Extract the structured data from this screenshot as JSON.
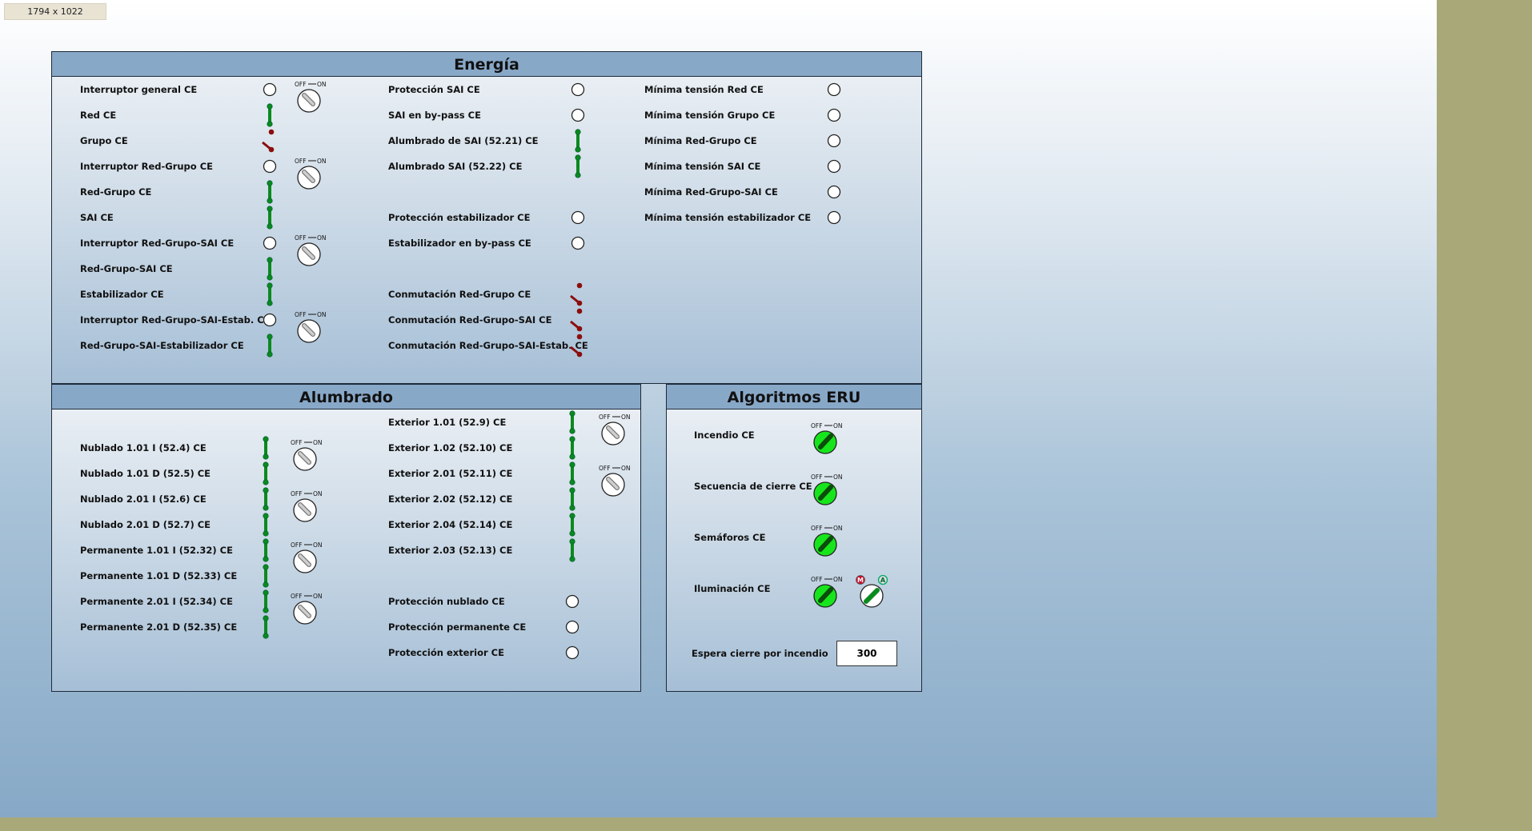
{
  "resolution_label": "1794 x 1022",
  "energia": {
    "title": "Energía",
    "col1": [
      {
        "label": "Interruptor general CE",
        "ind": "circle",
        "knob": "off"
      },
      {
        "label": "Red CE",
        "ind": "closed"
      },
      {
        "label": "Grupo CE",
        "ind": "open"
      },
      {
        "label": "Interruptor Red-Grupo CE",
        "ind": "circle",
        "knob": "off"
      },
      {
        "label": "Red-Grupo CE",
        "ind": "closed"
      },
      {
        "label": "SAI CE",
        "ind": "closed"
      },
      {
        "label": "Interruptor Red-Grupo-SAI CE",
        "ind": "circle",
        "knob": "off"
      },
      {
        "label": "Red-Grupo-SAI CE",
        "ind": "closed"
      },
      {
        "label": "Estabilizador CE",
        "ind": "closed"
      },
      {
        "label": "Interruptor Red-Grupo-SAI-Estab. CE",
        "ind": "circle",
        "knob": "off"
      },
      {
        "label": "Red-Grupo-SAI-Estabilizador CE",
        "ind": "closed"
      }
    ],
    "col2": [
      {
        "label": "Protección SAI CE",
        "ind": "circle"
      },
      {
        "label": "SAI en by-pass CE",
        "ind": "circle"
      },
      {
        "label": "Alumbrado de SAI (52.21) CE",
        "ind": "closed"
      },
      {
        "label": "Alumbrado SAI (52.22) CE",
        "ind": "closed"
      },
      null,
      {
        "label": "Protección estabilizador CE",
        "ind": "circle"
      },
      {
        "label": "Estabilizador en by-pass CE",
        "ind": "circle"
      },
      null,
      {
        "label": "Conmutación Red-Grupo CE",
        "ind": "open"
      },
      {
        "label": "Conmutación Red-Grupo-SAI CE",
        "ind": "open"
      },
      {
        "label": "Conmutación Red-Grupo-SAI-Estab. CE",
        "ind": "open"
      }
    ],
    "col3": [
      {
        "label": "Mínima tensión Red CE",
        "ind": "circle"
      },
      {
        "label": "Mínima tensión Grupo CE",
        "ind": "circle"
      },
      {
        "label": "Mínima Red-Grupo CE",
        "ind": "circle"
      },
      {
        "label": "Mínima tensión SAI CE",
        "ind": "circle"
      },
      {
        "label": "Mínima Red-Grupo-SAI CE",
        "ind": "circle"
      },
      {
        "label": "Mínima tensión estabilizador CE",
        "ind": "circle"
      }
    ]
  },
  "alumbrado": {
    "title": "Alumbrado",
    "col1": [
      {
        "label": "Nublado 1.01 I (52.4) CE",
        "ind": "closed",
        "knob": "off"
      },
      {
        "label": "Nublado 1.01 D (52.5) CE",
        "ind": "closed"
      },
      {
        "label": "Nublado 2.01 I (52.6) CE",
        "ind": "closed",
        "knob": "off"
      },
      {
        "label": "Nublado 2.01 D (52.7) CE",
        "ind": "closed"
      },
      {
        "label": "Permanente 1.01 I (52.32) CE",
        "ind": "closed",
        "knob": "off"
      },
      {
        "label": "Permanente 1.01 D (52.33) CE",
        "ind": "closed"
      },
      {
        "label": "Permanente 2.01 I (52.34) CE",
        "ind": "closed",
        "knob": "off"
      },
      {
        "label": "Permanente 2.01 D (52.35) CE",
        "ind": "closed"
      }
    ],
    "col2": [
      {
        "label": "Exterior 1.01 (52.9) CE",
        "ind": "closed",
        "knob": "off"
      },
      {
        "label": "Exterior 1.02 (52.10) CE",
        "ind": "closed"
      },
      {
        "label": "Exterior 2.01 (52.11) CE",
        "ind": "closed",
        "knob": "off"
      },
      {
        "label": "Exterior 2.02 (52.12) CE",
        "ind": "closed"
      },
      {
        "label": "Exterior 2.04 (52.14) CE",
        "ind": "closed"
      },
      {
        "label": "Exterior 2.03 (52.13) CE",
        "ind": "closed"
      },
      null,
      {
        "label": "Protección nublado CE",
        "ind": "circle"
      },
      {
        "label": "Protección permanente CE",
        "ind": "circle"
      },
      {
        "label": "Protección exterior CE",
        "ind": "circle"
      }
    ]
  },
  "algoritmos": {
    "title": "Algoritmos ERU",
    "rows": [
      {
        "label": "Incendio CE",
        "knob": "on"
      },
      {
        "label": "Secuencia de cierre CE",
        "knob": "on"
      },
      {
        "label": "Semáforos CE",
        "knob": "on"
      },
      {
        "label": "Iluminación CE",
        "knob": "on",
        "mode_switch": "A"
      }
    ],
    "wait_label": "Espera cierre por incendio",
    "wait_value": "300"
  },
  "switch_text": {
    "off": "OFF",
    "on": "ON",
    "manual": "M",
    "auto": "A"
  },
  "colors": {
    "closed_green": "#0b8a1e",
    "open_red": "#8b0d0d",
    "knob_on": "#17e51c",
    "title_bar": "#88a8c8"
  }
}
